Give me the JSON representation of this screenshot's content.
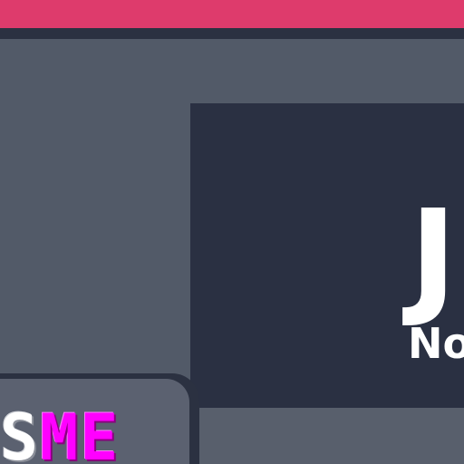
{
  "header": {
    "accent_color": "#de3b6c"
  },
  "preview": {
    "letter": "J",
    "caption": "No"
  },
  "card": {
    "text_a": "S",
    "text_b": "ME",
    "text_a_color": "#ffffff",
    "text_b_color": "#ff00ff"
  }
}
